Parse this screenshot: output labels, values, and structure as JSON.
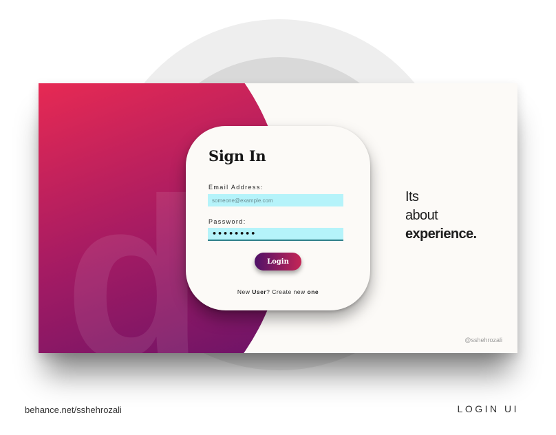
{
  "brand": {
    "tagline_line1": "Its",
    "tagline_line2": "about",
    "tagline_line3": "experience.",
    "credit_handle": "@sshehrozali",
    "watermark_letter": "d"
  },
  "signin": {
    "title": "Sign In",
    "email_label": "Email Address:",
    "email_placeholder": "someone@example.com",
    "email_value": "",
    "password_label": "Password:",
    "password_value": "••••••••",
    "login_label": "Login",
    "signup_prefix": "New ",
    "signup_user": "User",
    "signup_middle": "? Create new ",
    "signup_one": "one"
  },
  "footer": {
    "left": "behance.net/sshehrozali",
    "right": "LOGIN UI"
  },
  "colors": {
    "gradient_start": "#f5344b",
    "gradient_end": "#4a0f6a",
    "input_bg": "#b5f3fa",
    "button_start": "#4f1168",
    "button_end": "#c42656",
    "card_bg": "#fcfaf7"
  }
}
